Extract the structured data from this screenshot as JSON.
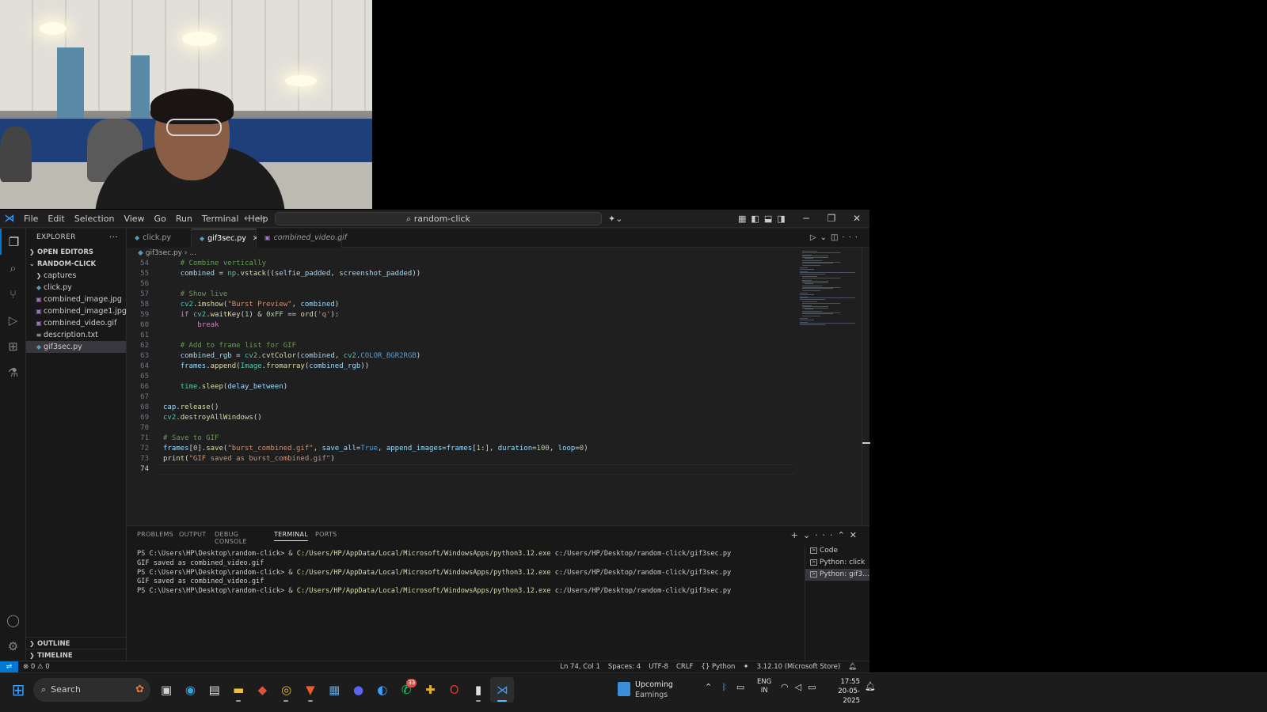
{
  "colors": {
    "accent": "#0078d4",
    "editor_bg": "#1f1f1f",
    "sidebar_bg": "#181818",
    "comment": "#6a9955",
    "string": "#ce9178",
    "function": "#dcdcaa",
    "variable": "#9cdcfe",
    "keyword": "#c586c0"
  },
  "titlebar": {
    "menu": [
      "File",
      "Edit",
      "Selection",
      "View",
      "Go",
      "Run",
      "Terminal",
      "Help"
    ],
    "command_center": "random-click",
    "nav_icons": [
      "arrow-left-icon",
      "arrow-right-icon"
    ],
    "window_controls": [
      "minimize-icon",
      "restore-icon",
      "close-icon"
    ]
  },
  "activity_bar": [
    "explorer-icon",
    "search-icon",
    "source-control-icon",
    "run-debug-icon",
    "extensions-icon",
    "testing-icon",
    "account-icon",
    "manage-gear-icon"
  ],
  "sidebar": {
    "title": "EXPLORER",
    "open_editors": "OPEN EDITORS",
    "folder": "RANDOM-CLICK",
    "items": [
      {
        "label": "captures",
        "kind": "folder"
      },
      {
        "label": "click.py",
        "kind": "py"
      },
      {
        "label": "combined_image.jpg",
        "kind": "img"
      },
      {
        "label": "combined_image1.jpg",
        "kind": "img"
      },
      {
        "label": "combined_video.gif",
        "kind": "img"
      },
      {
        "label": "description.txt",
        "kind": "txt"
      },
      {
        "label": "gif3sec.py",
        "kind": "py",
        "selected": true
      }
    ],
    "outline": "OUTLINE",
    "timeline": "TIMELINE"
  },
  "tabs": [
    {
      "label": "click.py",
      "active": false
    },
    {
      "label": "gif3sec.py",
      "active": true
    },
    {
      "label": "combined_video.gif",
      "active": false
    }
  ],
  "breadcrumb": {
    "file": "gif3sec.py",
    "rest": "..."
  },
  "code": {
    "current_line": "74",
    "lines": [
      {
        "n": "54",
        "indent": "    ",
        "tokens": [
          {
            "t": "# Combine vertically",
            "c": "com"
          }
        ]
      },
      {
        "n": "55",
        "indent": "    ",
        "tokens": [
          {
            "t": "combined",
            "c": "var"
          },
          {
            "t": " = ",
            "c": "op"
          },
          {
            "t": "np",
            "c": "cls"
          },
          {
            "t": ".",
            "c": "op"
          },
          {
            "t": "vstack",
            "c": "fn"
          },
          {
            "t": "((",
            "c": "op"
          },
          {
            "t": "selfie_padded",
            "c": "var"
          },
          {
            "t": ", ",
            "c": "op"
          },
          {
            "t": "screenshot_padded",
            "c": "var"
          },
          {
            "t": "))",
            "c": "op"
          }
        ]
      },
      {
        "n": "56",
        "indent": "",
        "tokens": []
      },
      {
        "n": "57",
        "indent": "    ",
        "tokens": [
          {
            "t": "# Show live",
            "c": "com"
          }
        ]
      },
      {
        "n": "58",
        "indent": "    ",
        "tokens": [
          {
            "t": "cv2",
            "c": "cls"
          },
          {
            "t": ".",
            "c": "op"
          },
          {
            "t": "imshow",
            "c": "fn"
          },
          {
            "t": "(",
            "c": "op"
          },
          {
            "t": "\"Burst Preview\"",
            "c": "str"
          },
          {
            "t": ", ",
            "c": "op"
          },
          {
            "t": "combined",
            "c": "var"
          },
          {
            "t": ")",
            "c": "op"
          }
        ]
      },
      {
        "n": "59",
        "indent": "    ",
        "tokens": [
          {
            "t": "if",
            "c": "kw"
          },
          {
            "t": " ",
            "c": "op"
          },
          {
            "t": "cv2",
            "c": "cls"
          },
          {
            "t": ".",
            "c": "op"
          },
          {
            "t": "waitKey",
            "c": "fn"
          },
          {
            "t": "(",
            "c": "op"
          },
          {
            "t": "1",
            "c": "num"
          },
          {
            "t": ") & ",
            "c": "op"
          },
          {
            "t": "0xFF",
            "c": "num"
          },
          {
            "t": " == ",
            "c": "op"
          },
          {
            "t": "ord",
            "c": "fn"
          },
          {
            "t": "(",
            "c": "op"
          },
          {
            "t": "'q'",
            "c": "str"
          },
          {
            "t": "):",
            "c": "op"
          }
        ]
      },
      {
        "n": "60",
        "indent": "        ",
        "tokens": [
          {
            "t": "break",
            "c": "kw"
          }
        ]
      },
      {
        "n": "61",
        "indent": "",
        "tokens": []
      },
      {
        "n": "62",
        "indent": "    ",
        "tokens": [
          {
            "t": "# Add to frame list for GIF",
            "c": "com"
          }
        ]
      },
      {
        "n": "63",
        "indent": "    ",
        "tokens": [
          {
            "t": "combined_rgb",
            "c": "var"
          },
          {
            "t": " = ",
            "c": "op"
          },
          {
            "t": "cv2",
            "c": "cls"
          },
          {
            "t": ".",
            "c": "op"
          },
          {
            "t": "cvtColor",
            "c": "fn"
          },
          {
            "t": "(",
            "c": "op"
          },
          {
            "t": "combined",
            "c": "var"
          },
          {
            "t": ", ",
            "c": "op"
          },
          {
            "t": "cv2",
            "c": "cls"
          },
          {
            "t": ".",
            "c": "op"
          },
          {
            "t": "COLOR_BGR2RGB",
            "c": "const"
          },
          {
            "t": ")",
            "c": "op"
          }
        ]
      },
      {
        "n": "64",
        "indent": "    ",
        "tokens": [
          {
            "t": "frames",
            "c": "var"
          },
          {
            "t": ".",
            "c": "op"
          },
          {
            "t": "append",
            "c": "fn"
          },
          {
            "t": "(",
            "c": "op"
          },
          {
            "t": "Image",
            "c": "cls"
          },
          {
            "t": ".",
            "c": "op"
          },
          {
            "t": "fromarray",
            "c": "fn"
          },
          {
            "t": "(",
            "c": "op"
          },
          {
            "t": "combined_rgb",
            "c": "var"
          },
          {
            "t": "))",
            "c": "op"
          }
        ]
      },
      {
        "n": "65",
        "indent": "",
        "tokens": []
      },
      {
        "n": "66",
        "indent": "    ",
        "tokens": [
          {
            "t": "time",
            "c": "cls"
          },
          {
            "t": ".",
            "c": "op"
          },
          {
            "t": "sleep",
            "c": "fn"
          },
          {
            "t": "(",
            "c": "op"
          },
          {
            "t": "delay_between",
            "c": "var"
          },
          {
            "t": ")",
            "c": "op"
          }
        ]
      },
      {
        "n": "67",
        "indent": "",
        "tokens": []
      },
      {
        "n": "68",
        "indent": "",
        "tokens": [
          {
            "t": "cap",
            "c": "var"
          },
          {
            "t": ".",
            "c": "op"
          },
          {
            "t": "release",
            "c": "fn"
          },
          {
            "t": "()",
            "c": "op"
          }
        ]
      },
      {
        "n": "69",
        "indent": "",
        "tokens": [
          {
            "t": "cv2",
            "c": "cls"
          },
          {
            "t": ".",
            "c": "op"
          },
          {
            "t": "destroyAllWindows",
            "c": "fn"
          },
          {
            "t": "()",
            "c": "op"
          }
        ]
      },
      {
        "n": "70",
        "indent": "",
        "tokens": []
      },
      {
        "n": "71",
        "indent": "",
        "tokens": [
          {
            "t": "# Save to GIF",
            "c": "com"
          }
        ]
      },
      {
        "n": "72",
        "indent": "",
        "tokens": [
          {
            "t": "frames",
            "c": "var"
          },
          {
            "t": "[",
            "c": "op"
          },
          {
            "t": "0",
            "c": "num"
          },
          {
            "t": "].",
            "c": "op"
          },
          {
            "t": "save",
            "c": "fn"
          },
          {
            "t": "(",
            "c": "op"
          },
          {
            "t": "\"burst_combined.gif\"",
            "c": "str"
          },
          {
            "t": ", ",
            "c": "op"
          },
          {
            "t": "save_all",
            "c": "var"
          },
          {
            "t": "=",
            "c": "op"
          },
          {
            "t": "True",
            "c": "const"
          },
          {
            "t": ", ",
            "c": "op"
          },
          {
            "t": "append_images",
            "c": "var"
          },
          {
            "t": "=",
            "c": "op"
          },
          {
            "t": "frames",
            "c": "var"
          },
          {
            "t": "[",
            "c": "op"
          },
          {
            "t": "1",
            "c": "num"
          },
          {
            "t": ":], ",
            "c": "op"
          },
          {
            "t": "duration",
            "c": "var"
          },
          {
            "t": "=",
            "c": "op"
          },
          {
            "t": "100",
            "c": "num"
          },
          {
            "t": ", ",
            "c": "op"
          },
          {
            "t": "loop",
            "c": "var"
          },
          {
            "t": "=",
            "c": "op"
          },
          {
            "t": "0",
            "c": "num"
          },
          {
            "t": ")",
            "c": "op"
          }
        ]
      },
      {
        "n": "73",
        "indent": "",
        "tokens": [
          {
            "t": "print",
            "c": "fn"
          },
          {
            "t": "(",
            "c": "op"
          },
          {
            "t": "\"GIF saved as burst_combined.gif\"",
            "c": "str"
          },
          {
            "t": ")",
            "c": "op"
          }
        ]
      },
      {
        "n": "74",
        "indent": "",
        "tokens": []
      }
    ]
  },
  "panel": {
    "tabs": [
      "PROBLEMS",
      "OUTPUT",
      "DEBUG CONSOLE",
      "TERMINAL",
      "PORTS"
    ],
    "active_tab": "TERMINAL",
    "terminal_lines": [
      {
        "prompt": "PS C:\\Users\\HP\\Desktop\\random-click> & ",
        "cmd": "C:/Users/HP/AppData/Local/Microsoft/WindowsApps/python3.12.exe",
        "arg": " c:/Users/HP/Desktop/random-click/gif3sec.py"
      },
      {
        "prompt": "GIF saved as combined_video.gif",
        "cmd": "",
        "arg": ""
      },
      {
        "prompt": "PS C:\\Users\\HP\\Desktop\\random-click> & ",
        "cmd": "C:/Users/HP/AppData/Local/Microsoft/WindowsApps/python3.12.exe",
        "arg": " c:/Users/HP/Desktop/random-click/gif3sec.py"
      },
      {
        "prompt": "GIF saved as combined_video.gif",
        "cmd": "",
        "arg": ""
      },
      {
        "prompt": "PS C:\\Users\\HP\\Desktop\\random-click> & ",
        "cmd": "C:/Users/HP/AppData/Local/Microsoft/WindowsApps/python3.12.exe",
        "arg": " c:/Users/HP/Desktop/random-click/gif3sec.py"
      }
    ],
    "terminals": [
      {
        "label": "Code",
        "selected": false
      },
      {
        "label": "Python: click",
        "selected": false
      },
      {
        "label": "Python: gif3...",
        "selected": true
      }
    ]
  },
  "statusbar": {
    "errors": "0",
    "warnings": "0",
    "position": "Ln 74, Col 1",
    "spaces": "Spaces: 4",
    "encoding": "UTF-8",
    "eol": "CRLF",
    "language": "Python",
    "interpreter": "3.12.10 (Microsoft Store)"
  },
  "taskbar": {
    "search_placeholder": "Search",
    "apps": [
      {
        "name": "task-view-icon",
        "glyph": "▣",
        "color": "#d0d0d0"
      },
      {
        "name": "edge-icon",
        "glyph": "◉",
        "color": "#2fa6e0"
      },
      {
        "name": "store-icon",
        "glyph": "▤",
        "color": "#e0e0e0"
      },
      {
        "name": "file-explorer-icon",
        "glyph": "▬",
        "color": "#f2c12e",
        "running": true
      },
      {
        "name": "git-icon",
        "glyph": "◆",
        "color": "#e0503a"
      },
      {
        "name": "chrome-icon",
        "glyph": "◎",
        "color": "#e8b72a",
        "running": true
      },
      {
        "name": "brave-icon",
        "glyph": "▼",
        "color": "#f05a28",
        "running": true
      },
      {
        "name": "photos-icon",
        "glyph": "▦",
        "color": "#5aa0d8"
      },
      {
        "name": "discord-icon",
        "glyph": "●",
        "color": "#5865f2"
      },
      {
        "name": "weather-icon",
        "glyph": "◐",
        "color": "#3aa0ff"
      },
      {
        "name": "whatsapp-icon",
        "glyph": "✆",
        "color": "#25d366",
        "badge": "33"
      },
      {
        "name": "slack-icon",
        "glyph": "✚",
        "color": "#e0b02a"
      },
      {
        "name": "opera-icon",
        "glyph": "O",
        "color": "#e0302a"
      },
      {
        "name": "audio-meter-icon",
        "glyph": "▮",
        "color": "#e0e0e0",
        "running": true
      },
      {
        "name": "vscode-icon",
        "glyph": "⋊",
        "color": "#3aa0ff",
        "active": true
      }
    ],
    "widget": {
      "line1": "Upcoming",
      "line2": "Earnings"
    },
    "lang_top": "ENG",
    "lang_bottom": "IN",
    "time": "17:55",
    "date": "20-05-2025"
  }
}
